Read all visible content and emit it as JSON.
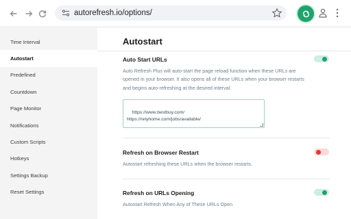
{
  "browser": {
    "url": "autorefresh.io/options/",
    "icons": [
      "back-arrow-icon",
      "forward-arrow-icon",
      "reload-icon",
      "site-settings-icon",
      "bookmark-star-icon",
      "auto-refresh-extension-icon",
      "profile-icon",
      "kebab-menu-icon"
    ]
  },
  "sidebar": {
    "items": [
      {
        "label": "Time Interval"
      },
      {
        "label": "Autostart"
      },
      {
        "label": "Predefined"
      },
      {
        "label": "Countdown"
      },
      {
        "label": "Page Monitor"
      },
      {
        "label": "Notifications"
      },
      {
        "label": "Custom Scripts"
      },
      {
        "label": "Hotkeys"
      },
      {
        "label": "Settings Backup"
      },
      {
        "label": "Reset Settings"
      }
    ],
    "active_index": 1
  },
  "main": {
    "title": "Autostart",
    "sections": [
      {
        "title": "Auto Start URLs",
        "description": "Auto Refresh Plus will auto-start the page reload function when these URLs are opened in your browser. It also opens all of these URLs when your browser restarts and begins auto-refreshing at the desired interval.",
        "enabled": true,
        "urls": "https://www.bestbuy.com/\nhttps://relyhome.com/jobs/available/"
      },
      {
        "title": "Refresh on Browser Restart",
        "description": "Autostart refreshing these URLs when the browser restarts.",
        "enabled": false
      },
      {
        "title": "Refresh on URLs Opening",
        "description": "Autostart Refresh When Any of These URLs Open",
        "enabled": true
      }
    ]
  },
  "colors": {
    "accent": "#1fa36b",
    "toggle_off": "#e53935",
    "sidebar_bg": "#f4f4f4",
    "description_text": "#6b7f8e"
  }
}
